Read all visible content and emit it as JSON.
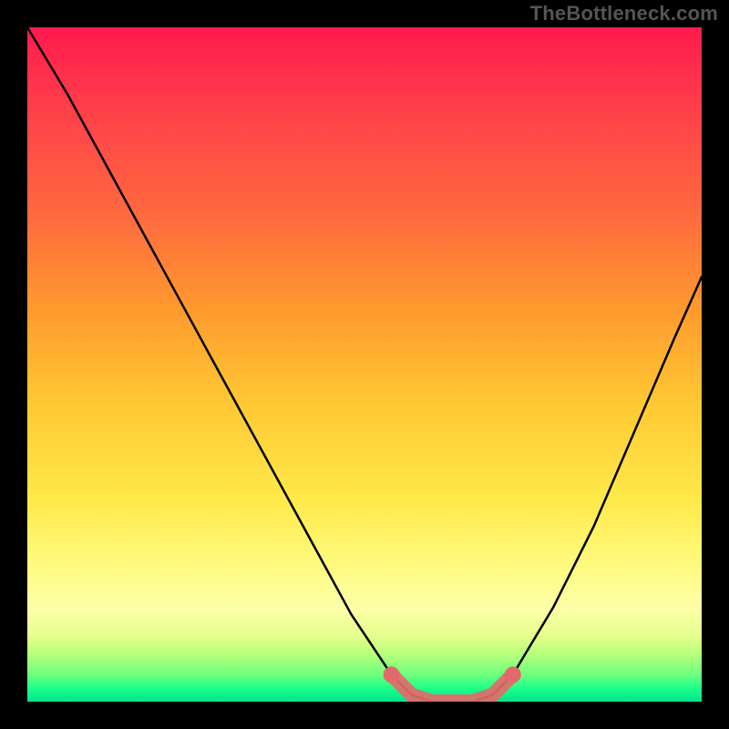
{
  "watermark": "TheBottleneck.com",
  "chart_data": {
    "type": "line",
    "title": "",
    "xlabel": "",
    "ylabel": "",
    "xlim": [
      0,
      100
    ],
    "ylim": [
      0,
      100
    ],
    "series": [
      {
        "name": "bottleneck-curve",
        "x": [
          0,
          6,
          12,
          18,
          24,
          30,
          36,
          42,
          48,
          54,
          57,
          60,
          63,
          66,
          69,
          72,
          78,
          84,
          90,
          96,
          100
        ],
        "y": [
          100,
          90,
          79,
          68,
          57,
          46,
          35,
          24,
          13,
          4,
          1,
          0,
          0,
          0,
          1,
          4,
          14,
          26,
          40,
          54,
          63
        ]
      },
      {
        "name": "highlight-band",
        "x": [
          54,
          57,
          60,
          63,
          66,
          69,
          72
        ],
        "y": [
          4,
          1,
          0,
          0,
          0,
          1,
          4
        ]
      }
    ],
    "gradient_stops": [
      {
        "pos": 0,
        "color": "#ff1a4d"
      },
      {
        "pos": 12,
        "color": "#ff3f4a"
      },
      {
        "pos": 28,
        "color": "#ff6a3e"
      },
      {
        "pos": 42,
        "color": "#ff9a2e"
      },
      {
        "pos": 56,
        "color": "#ffc933"
      },
      {
        "pos": 70,
        "color": "#ffe94a"
      },
      {
        "pos": 80,
        "color": "#fffb80"
      },
      {
        "pos": 86,
        "color": "#fdffa8"
      },
      {
        "pos": 90,
        "color": "#e8ff8f"
      },
      {
        "pos": 93,
        "color": "#b6ff7a"
      },
      {
        "pos": 96,
        "color": "#6dff7d"
      },
      {
        "pos": 98,
        "color": "#1cff8a"
      },
      {
        "pos": 100,
        "color": "#00e58b"
      }
    ],
    "highlight_color": "#e36a6a",
    "curve_color": "#000000"
  }
}
